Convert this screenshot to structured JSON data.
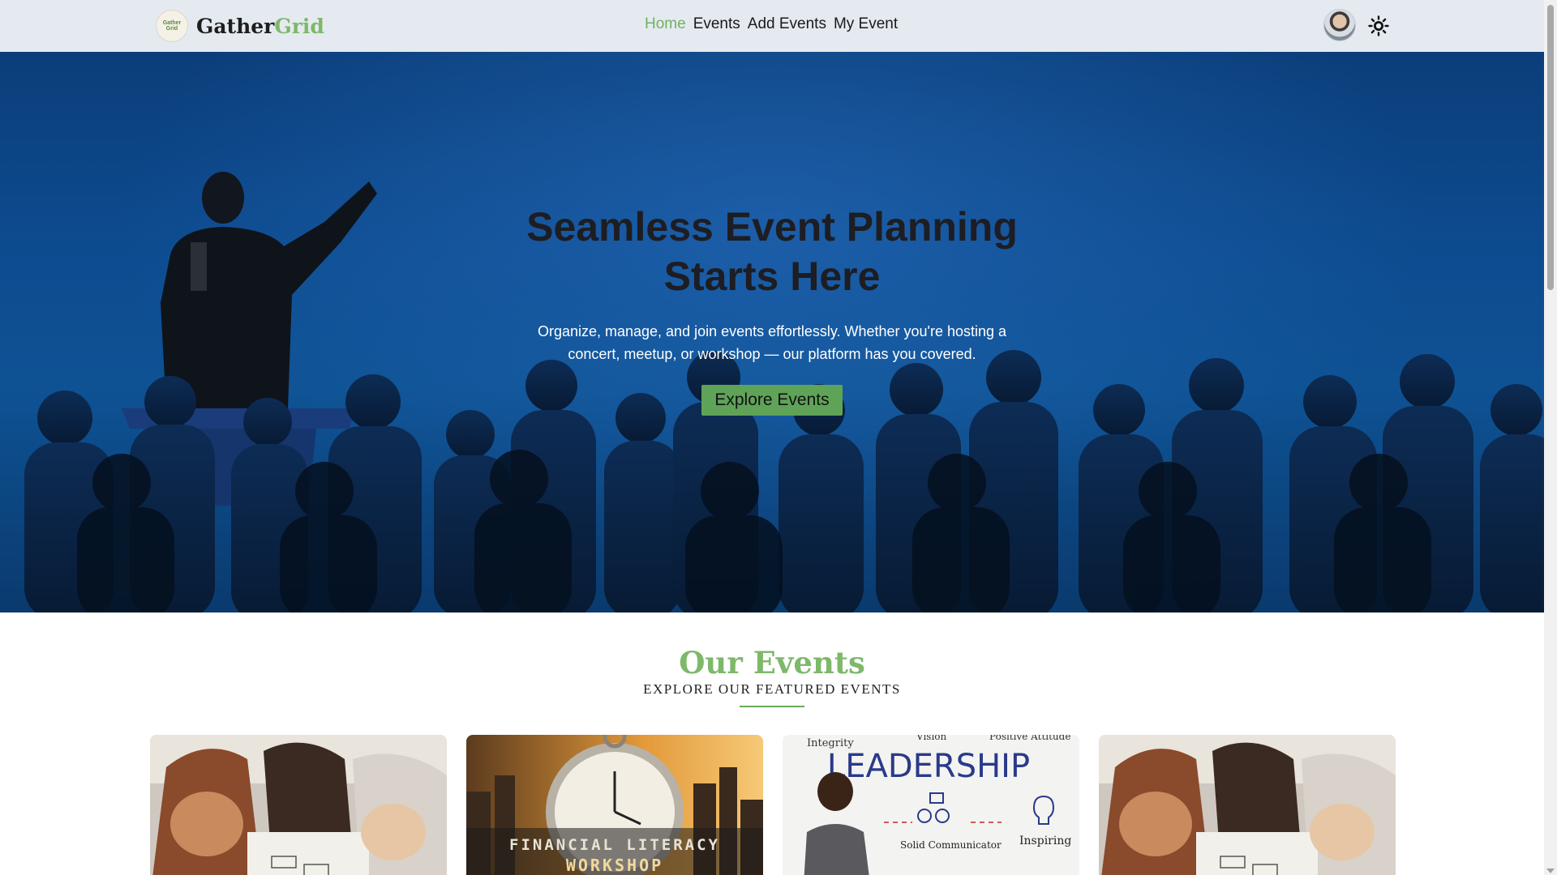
{
  "brand": {
    "logo_text": "Gather Grid",
    "name_part1": "Gather",
    "name_part2": "Grid"
  },
  "nav": {
    "items": [
      {
        "label": "Home",
        "active": true
      },
      {
        "label": "Events",
        "active": false
      },
      {
        "label": "Add Events",
        "active": false
      },
      {
        "label": "My Event",
        "active": false
      }
    ]
  },
  "user": {
    "avatar_icon": "user-avatar",
    "theme_icon": "sun-icon"
  },
  "hero": {
    "title": "Seamless Event Planning Starts Here",
    "subtitle": "Organize, manage, and join events effortlessly. Whether you're hosting a concert, meetup, or workshop — our platform has you covered.",
    "cta_label": "Explore Events"
  },
  "events_section": {
    "title": "Our Events",
    "subtitle": "EXPLORE OUR FEATURED EVENTS"
  },
  "cards": [
    {
      "image": "group-workshop-photo"
    },
    {
      "image": "financial-literacy-workshop-photo",
      "overlay_line1": "FINANCIAL LITERACY",
      "overlay_line2": "WORKSHOP"
    },
    {
      "image": "leadership-training-photo",
      "words": [
        "Integrity",
        "Vision",
        "Positive Attitude",
        "LEADERSHIP",
        "Solid Communicator",
        "Inspiring"
      ]
    },
    {
      "image": "group-workshop-photo"
    }
  ],
  "colors": {
    "accent": "#7eb86a",
    "nav_bg": "#e5eaf0",
    "hero_blue": "#0d4b8f",
    "button": "#5fa358"
  }
}
